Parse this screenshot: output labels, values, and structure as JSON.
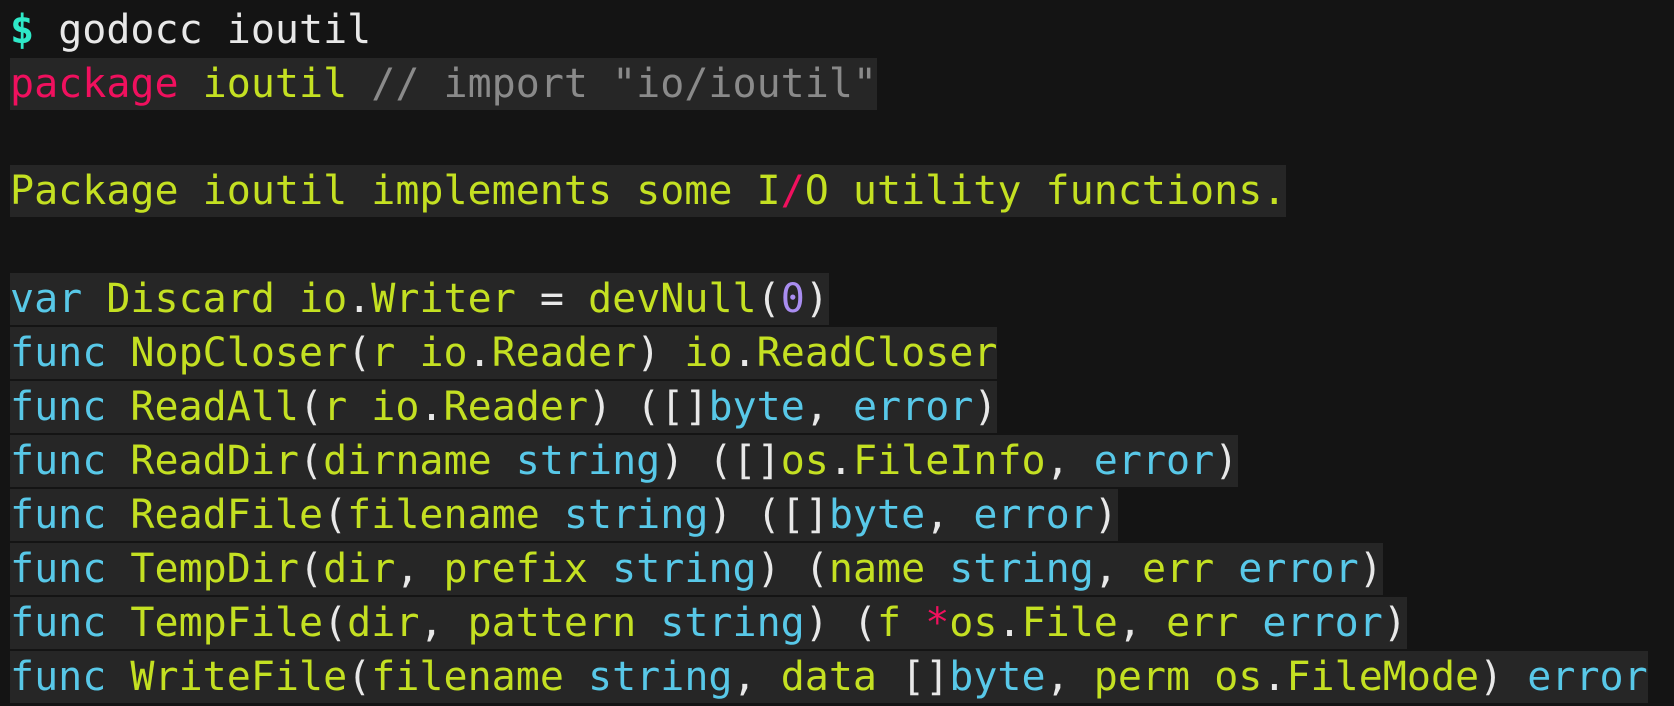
{
  "prompt": {
    "symbol": "$",
    "command": "godocc ioutil"
  },
  "package_line": {
    "keyword": "package",
    "name": "ioutil",
    "comment": "// import \"io/ioutil\""
  },
  "doc": {
    "before": "Package ioutil implements some I",
    "slash": "/",
    "after": "O utility functions."
  },
  "decls": {
    "discard": {
      "kw": "var",
      "name": "Discard",
      "type_pkg": "io",
      "type_name": "Writer",
      "eq": "=",
      "func": "devNull",
      "arg": "0"
    },
    "nopcloser": {
      "kw": "func",
      "name": "NopCloser",
      "param": "r",
      "param_pkg": "io",
      "param_type": "Reader",
      "ret_pkg": "io",
      "ret_type": "ReadCloser"
    },
    "readall": {
      "kw": "func",
      "name": "ReadAll",
      "param": "r",
      "param_pkg": "io",
      "param_type": "Reader",
      "ret1": "byte",
      "ret2": "error"
    },
    "readdir": {
      "kw": "func",
      "name": "ReadDir",
      "param": "dirname",
      "param_type": "string",
      "ret1_pkg": "os",
      "ret1_type": "FileInfo",
      "ret2": "error"
    },
    "readfile": {
      "kw": "func",
      "name": "ReadFile",
      "param": "filename",
      "param_type": "string",
      "ret1": "byte",
      "ret2": "error"
    },
    "tempdir": {
      "kw": "func",
      "name": "TempDir",
      "p1": "dir",
      "p2": "prefix",
      "ptype": "string",
      "r1": "name",
      "r1type": "string",
      "r2": "err",
      "r2type": "error"
    },
    "tempfile": {
      "kw": "func",
      "name": "TempFile",
      "p1": "dir",
      "p2": "pattern",
      "ptype": "string",
      "r1": "f",
      "r1ptr": "*",
      "r1pkg": "os",
      "r1type": "File",
      "r2": "err",
      "r2type": "error"
    },
    "writefile": {
      "kw": "func",
      "name": "WriteFile",
      "p1": "filename",
      "p1type": "string",
      "p2": "data",
      "p2type": "byte",
      "p3": "perm",
      "p3pkg": "os",
      "p3type": "FileMode",
      "ret": "error"
    }
  },
  "partial_last_line": "func"
}
